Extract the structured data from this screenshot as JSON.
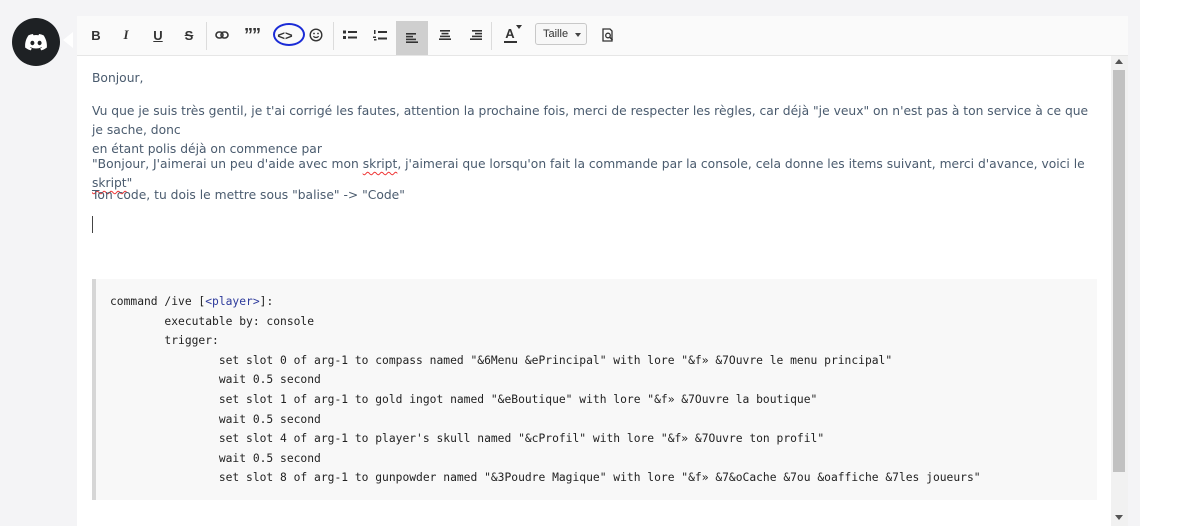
{
  "toolbar": {
    "bold": "B",
    "italic": "I",
    "underline": "U",
    "strike": "S",
    "quote": "””",
    "code": "<>",
    "smiley": "☺",
    "font_color": "A",
    "size_label": "Taille"
  },
  "message": {
    "greeting": "Bonjour,",
    "line2_a": "Vu que je suis très gentil, je t'ai corrigé les fautes, attention la prochaine fois, merci de respecter les règles, car déjà \"je veux\" on n'est pas à ton service à ce que je sache, donc",
    "line2_b": "en étant polis déjà on commence par",
    "line3_a": "\"Bonjour, J'aimerai un peu d'aide avec mon ",
    "line3_skript1": "skript",
    "line3_b": ", j'aimerai que lorsqu'on fait la commande par la console, cela donne les items suivant, merci d'avance, voici le ",
    "line3_skript2": "skript",
    "line3_c": "\"",
    "line4": "Ton code, tu dois le mettre sous \"balise\" -> \"Code\""
  },
  "code": {
    "l1_a": "command /ive [",
    "l1_player": "<player>",
    "l1_b": "]:",
    "l2": "        executable by: console",
    "l3": "        trigger:",
    "l4": "                set slot 0 of arg-1 to compass named \"&6Menu &ePrincipal\" with lore \"&f» &7Ouvre le menu principal\"",
    "l5": "                wait 0.5 second",
    "l6": "                set slot 1 of arg-1 to gold ingot named \"&eBoutique\" with lore \"&f» &7Ouvre la boutique\"",
    "l7": "                wait 0.5 second",
    "l8": "                set slot 4 of arg-1 to player's skull named \"&cProfil\" with lore \"&f» &7Ouvre ton profil\"",
    "l9": "                wait 0.5 second",
    "l10": "                set slot 8 of arg-1 to gunpowder named \"&3Poudre Magique\" with lore \"&f» &7&oCache &7ou &oaffiche &7les joueurs\""
  },
  "colors": {
    "text": "#4a5b6e",
    "annotation": "#1a2bd6",
    "avatar_bg": "#1e2124"
  },
  "icons": [
    "discord-logo",
    "link-icon",
    "emoji-icon",
    "bullet-list-icon",
    "numbered-list-icon",
    "align-left-icon",
    "align-center-icon",
    "align-right-icon",
    "preview-icon"
  ]
}
